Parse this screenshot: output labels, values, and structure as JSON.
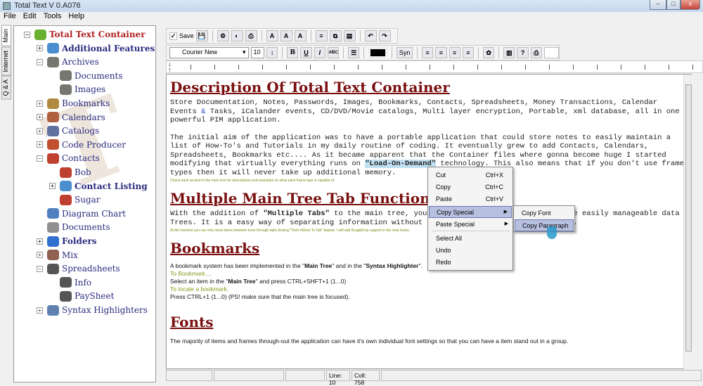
{
  "window": {
    "title": "Total Text V 0.A076",
    "minimize": "–",
    "maximize": "□",
    "close": "x"
  },
  "menu": [
    "File",
    "Edit",
    "Tools",
    "Help"
  ],
  "side_tabs": [
    "Main",
    "Internet",
    "Q & A"
  ],
  "tree": [
    {
      "label": "Total Text Container",
      "level": 0,
      "exp": "−",
      "style": "root",
      "color": "#6ab030"
    },
    {
      "label": "Additional Features",
      "level": 1,
      "exp": "+",
      "style": "bold",
      "color": "#4a90d0"
    },
    {
      "label": "Archives",
      "level": 1,
      "exp": "−",
      "color": "#777770"
    },
    {
      "label": "Documents",
      "level": 2,
      "color": "#777770"
    },
    {
      "label": "Images",
      "level": 2,
      "color": "#777770"
    },
    {
      "label": "Bookmarks",
      "level": 1,
      "exp": "+",
      "color": "#b08a40"
    },
    {
      "label": "Calendars",
      "level": 1,
      "exp": "+",
      "color": "#b06040"
    },
    {
      "label": "Catalogs",
      "level": 1,
      "exp": "+",
      "color": "#6070a0"
    },
    {
      "label": "Code Producer",
      "level": 1,
      "exp": "+",
      "color": "#c05030"
    },
    {
      "label": "Contacts",
      "level": 1,
      "exp": "−",
      "color": "#c04030"
    },
    {
      "label": "Bob",
      "level": 2,
      "color": "#c04030"
    },
    {
      "label": "Contact Listing",
      "level": 2,
      "exp": "+",
      "style": "bold",
      "color": "#4a90d0"
    },
    {
      "label": "Sugar",
      "level": 2,
      "color": "#c04030"
    },
    {
      "label": "Diagram Chart",
      "level": 1,
      "color": "#5080c0"
    },
    {
      "label": "Documents",
      "level": 1,
      "color": "#909090"
    },
    {
      "label": "Folders",
      "level": 1,
      "exp": "+",
      "style": "bold",
      "color": "#3070d0"
    },
    {
      "label": "Mix",
      "level": 1,
      "exp": "+",
      "color": "#906050"
    },
    {
      "label": "Spreadsheets",
      "level": 1,
      "exp": "−",
      "color": "#555"
    },
    {
      "label": "Info",
      "level": 2,
      "color": "#555"
    },
    {
      "label": "PaySheet",
      "level": 2,
      "color": "#555"
    },
    {
      "label": "Syntax Highlighters",
      "level": 1,
      "exp": "+",
      "color": "#6080b0"
    }
  ],
  "toolbar": {
    "save_label": "Save",
    "font": "Courier New",
    "size": "10",
    "syn": "Syn",
    "bold": "B",
    "underline": "U",
    "italic": "I",
    "strike": "ABC"
  },
  "doc": {
    "h1": "Description Of Total Text Container",
    "p1a": "Store Documentation, Notes, Passwords, Images, Bookmarks, Contacts, Spreadsheets, Money Transactions, Calendar Events ",
    "amp": "&",
    "p1b": " Tasks, iCalander events, CD/DVD/Movie catalogs, Multi layer encryption, Portable, xml database, all in one powerful PIM application.",
    "p2a": "The initial aim of the application was to have a portable application that could store notes to easily maintain a list of How-To's and Tutorials in my daily routine of coding. It eventually grew to add Contacts, Calendars, Spreadsheets, Bookmarks etc.... As it became apparent that the Container files where gonna become huge I started modifying that virtually everything runs on ",
    "p2hl": "\"Load-On-Demand\"",
    "p2b": " technology. This also means that if you don't use frame types then it will never take up additional memory.",
    "note1": "Check each section in the main tree for descriptions and examples on what each frame type is capable of.",
    "h2": "Multiple Main Tree Tab Functionality",
    "p3a": "With the addition of ",
    "p3b": "\"Multiple Tabs\"",
    "p3c": " to the main tree, you can now split your data into more easily manageable data Trees. It is a easy way of separating information without having additional container files.",
    "note2": "At the moment you can only move items between trees through right clicking \"Tool>>Move To Tab\" feature. I will add Drag&Drop support in the near future.",
    "h3": "Bookmarks",
    "b1a": "A bookmark system has been implemented in the \"",
    "b1b": "Main Tree",
    "b1c": "\" and in the \"",
    "b1d": "Syntax Highlighter",
    "b1e": "\".",
    "b2": "To Bookmark....",
    "b3a": "Select an item in the \"",
    "b3b": "Main Tree",
    "b3c": "\" and press CTRL+SHFT+1 (1...0)",
    "b4": "To locate a bookmark.",
    "b5": "Press CTRL+1 (1...0) (PS! make sure that the main tree is focused).",
    "h4": "Fonts",
    "f1": "The majority of items and frames through-out the application can have it's own individual font settings so that you can have a item stand out in a group."
  },
  "status": {
    "line": "Line: 10",
    "col": "Coll: 758"
  },
  "context_menu": [
    {
      "label": "Cut",
      "shortcut": "Ctrl+X"
    },
    {
      "label": "Copy",
      "shortcut": "Ctrl+C"
    },
    {
      "label": "Paste",
      "shortcut": "Ctrl+V"
    },
    {
      "label": "Copy Special",
      "submenu": true,
      "active": true
    },
    {
      "label": "Paste Special",
      "submenu": true
    },
    {
      "label": "Select All"
    },
    {
      "label": "Undo"
    },
    {
      "label": "Redo"
    }
  ],
  "submenu": [
    "Copy Font",
    "Copy Paragraph"
  ]
}
